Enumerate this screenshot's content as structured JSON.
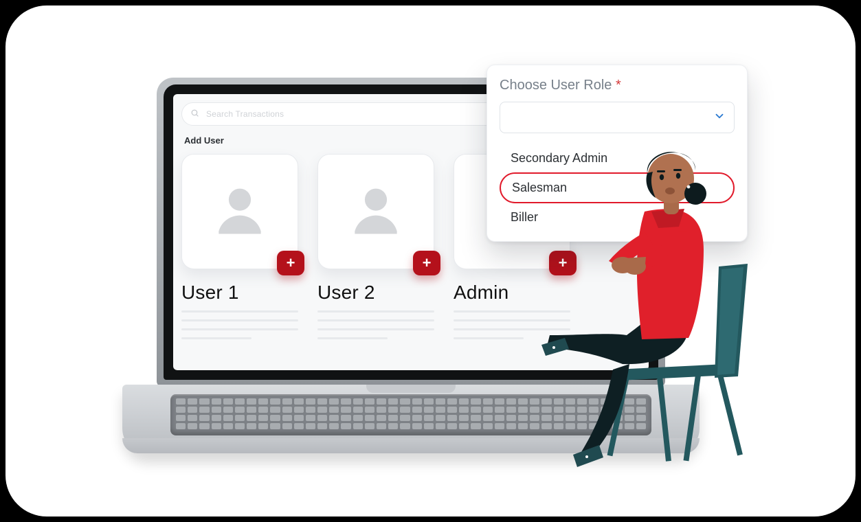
{
  "brand": {
    "accent": "#e11a2b",
    "chevron": "#2b7ad1",
    "badge": "#b4111b"
  },
  "topbar": {
    "search_placeholder": "Search Transactions",
    "add_button_label": "Add User"
  },
  "section": {
    "title": "Add User"
  },
  "cards": [
    {
      "label": "User 1"
    },
    {
      "label": "User 2"
    },
    {
      "label": "Admin"
    }
  ],
  "role_panel": {
    "title": "Choose User Role",
    "required_mark": "*",
    "selected": "Salesman",
    "options": [
      "Secondary Admin",
      "Salesman",
      "Biller"
    ]
  },
  "icons": {
    "search": "search-icon",
    "plus": "plus-icon",
    "chevron_down": "chevron-down-icon",
    "avatar": "avatar-icon"
  }
}
